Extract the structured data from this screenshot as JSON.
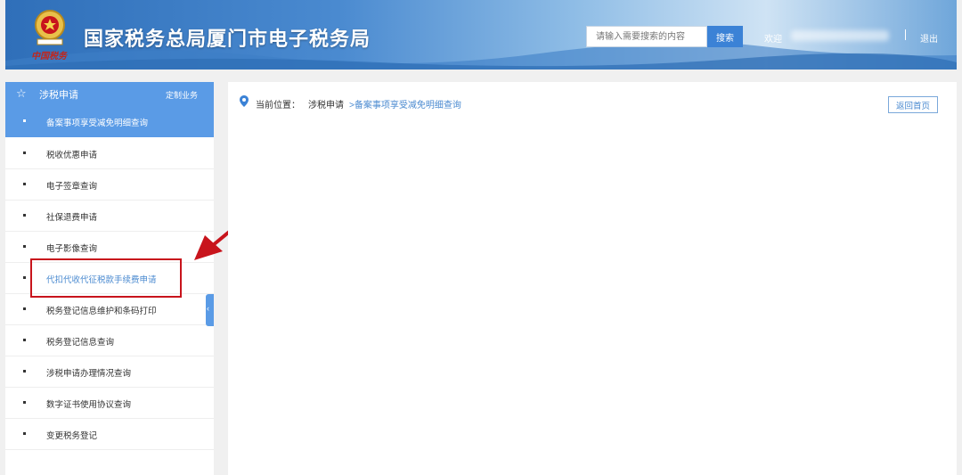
{
  "header": {
    "title": "国家税务总局厦门市电子税务局",
    "emblem_text": "中国税务",
    "search_placeholder": "请输入需要搜索的内容",
    "search_button": "搜索",
    "welcome": "欢迎",
    "separator": "|",
    "logout": "退出"
  },
  "sidebar": {
    "title": "涉税申请",
    "custom_link": "定制业务",
    "items": [
      {
        "label": "备案事项享受减免明细查询"
      },
      {
        "label": "税收优惠申请"
      },
      {
        "label": "电子签章查询"
      },
      {
        "label": "社保退费申请"
      },
      {
        "label": "电子影像查询"
      },
      {
        "label": "代扣代收代征税款手续费申请"
      },
      {
        "label": "税务登记信息维护和条码打印"
      },
      {
        "label": "税务登记信息查询"
      },
      {
        "label": "涉税申请办理情况查询"
      },
      {
        "label": "数字证书使用协议查询"
      },
      {
        "label": "变更税务登记"
      }
    ]
  },
  "main": {
    "breadcrumb_prefix": "当前位置：",
    "breadcrumb_parent": "涉税申请",
    "breadcrumb_current": ">备案事项享受减免明细查询",
    "home_button": "返回首页"
  },
  "colors": {
    "accent": "#5a9be6",
    "link": "#4a8ad0",
    "annotation": "#c8141c"
  },
  "icons": [
    "emblem-icon",
    "star-icon",
    "collapse-icon",
    "location-pin-icon",
    "annotation-arrow-icon"
  ]
}
